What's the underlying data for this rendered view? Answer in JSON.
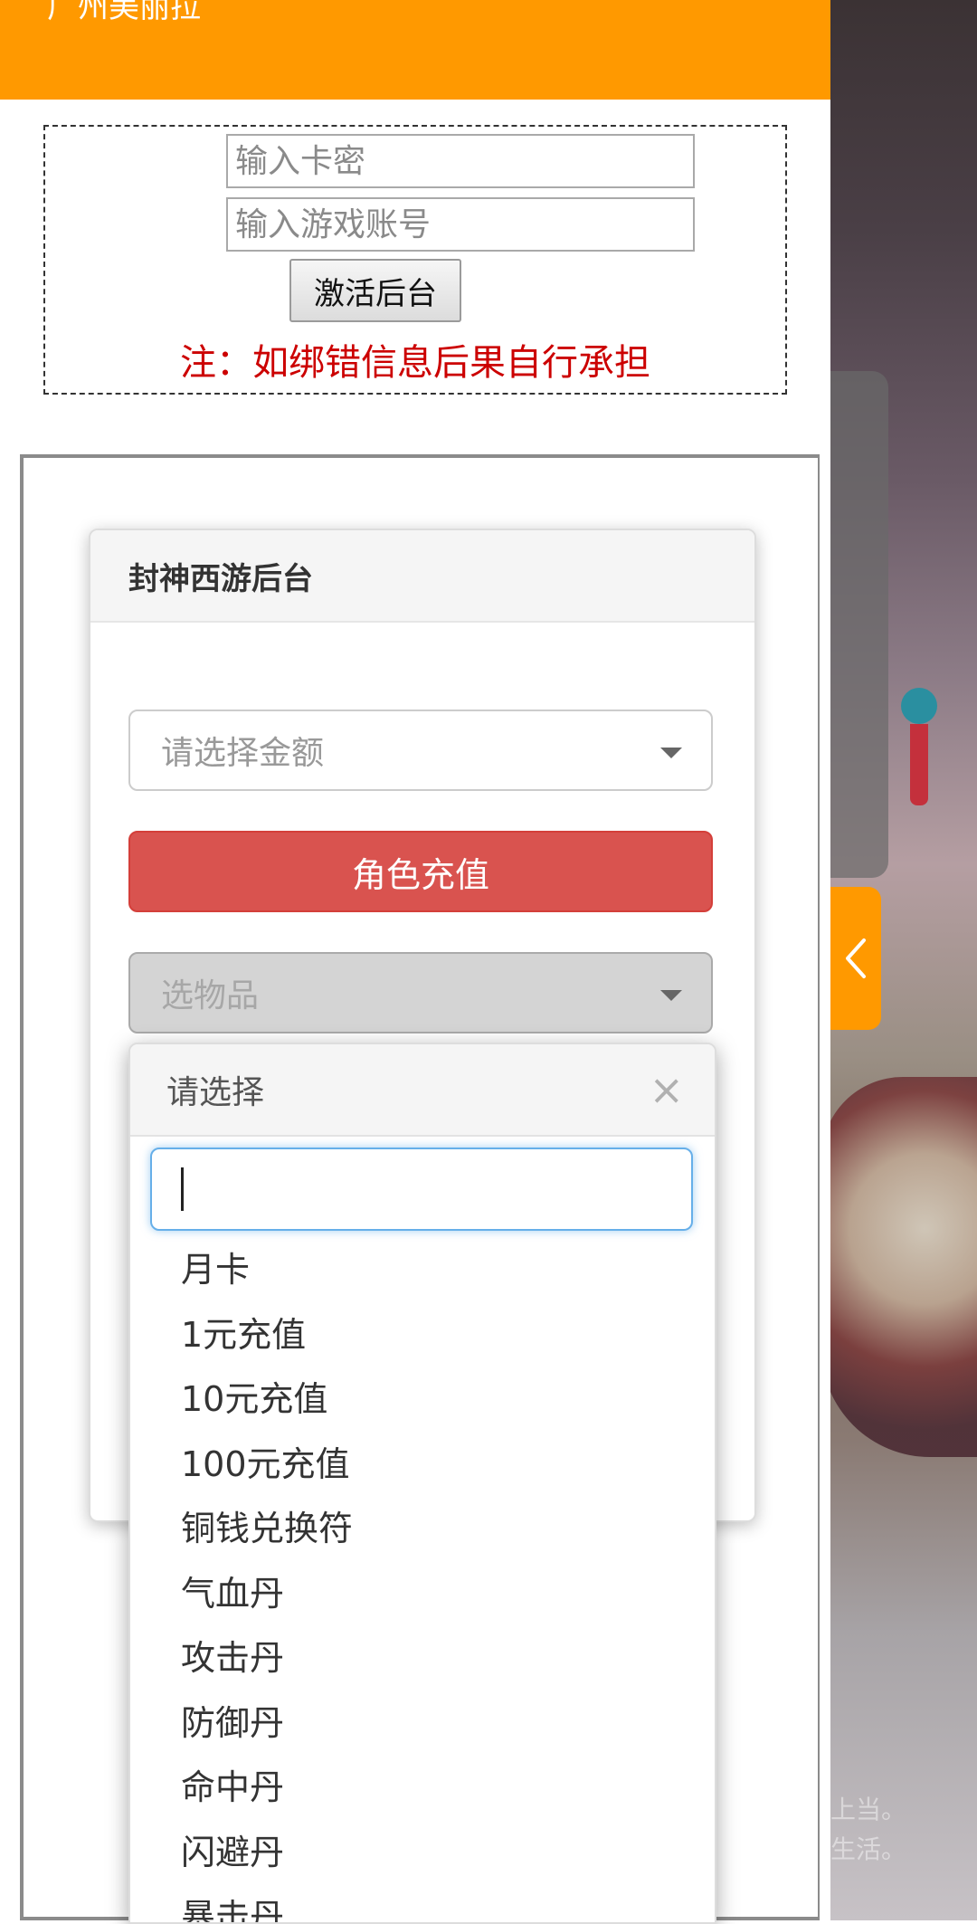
{
  "header": {
    "title": "广州美丽拉"
  },
  "activation": {
    "card_placeholder": "输入卡密",
    "account_placeholder": "输入游戏账号",
    "activate_label": "激活后台",
    "note": "注：如绑错信息后果自行承担"
  },
  "panel": {
    "title": "封神西游后台",
    "amount_select": "请选择金额",
    "recharge_button": "角色充值",
    "item_select": "选物品"
  },
  "dropdown": {
    "title": "请选择",
    "close": "×",
    "items": [
      "月卡",
      "1元充值",
      "10元充值",
      "100元充值",
      "铜钱兑换符",
      "气血丹",
      "攻击丹",
      "防御丹",
      "命中丹",
      "闪避丹",
      "暴击丹"
    ]
  },
  "background": {
    "tip_line1": "上当。",
    "tip_line2": "生活。"
  },
  "colors": {
    "header": "#ff9900",
    "note": "#cc0000",
    "button": "#d9534f",
    "focus": "#66afe9"
  }
}
